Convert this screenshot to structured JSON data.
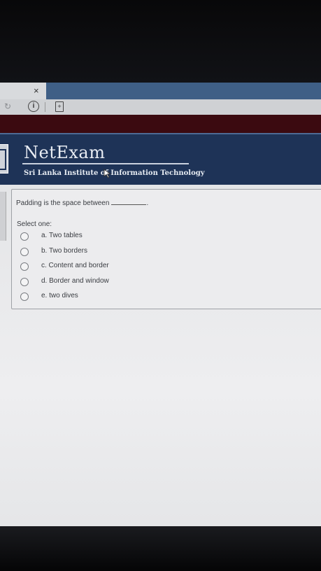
{
  "browser": {
    "tab_close_symbol": "×",
    "info_symbol": "i",
    "reload_symbol": "↻",
    "page_symbol": "+"
  },
  "header": {
    "brand": "NetExam",
    "institute": "Sri Lanka Institute of Information Technology"
  },
  "question": {
    "text": "Padding is the space between",
    "trailing": ".",
    "prompt": "Select one:",
    "options": [
      {
        "label": "a. Two tables"
      },
      {
        "label": "b. Two borders"
      },
      {
        "label": "c. Content and border"
      },
      {
        "label": "d. Border and window"
      },
      {
        "label": "e. two dives"
      }
    ]
  },
  "colors": {
    "header_bg": "#1e3357",
    "tabbar_bg": "#3f5f86",
    "maroon_bar": "#3b0a10"
  }
}
